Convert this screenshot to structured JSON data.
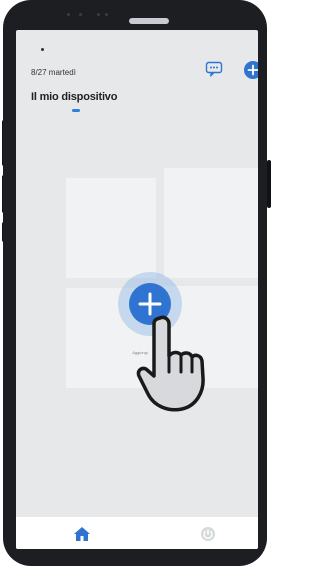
{
  "status_bar": {
    "date": "8/27 martedì"
  },
  "header": {
    "title": "Il mio dispositivo"
  },
  "icons": {
    "chat": "chat-icon",
    "add": "plus-icon",
    "home": "home-icon",
    "power": "power-icon",
    "hand": "pointing-hand-icon"
  },
  "main": {
    "add_device_label": "Aggiungi"
  },
  "tabs": [
    {
      "name": "home",
      "active": true
    },
    {
      "name": "power",
      "active": false
    }
  ],
  "colors": {
    "accent": "#2f74d0",
    "screen_bg": "#e6e8ea",
    "tab_inactive": "#cfd3d8"
  }
}
